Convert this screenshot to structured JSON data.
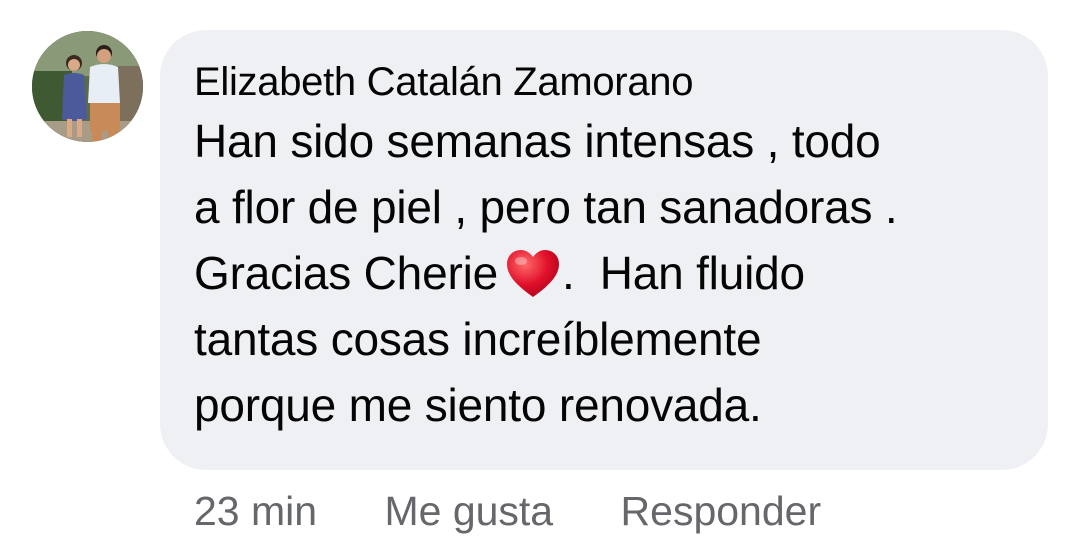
{
  "comment": {
    "author": "Elizabeth Catalán Zamorano",
    "lines": [
      "Han sido semanas intensas , todo",
      "a flor de piel , pero tan sanadoras .",
      "Gracias Cherie",
      ".  Han fluido",
      "tantas cosas increíblemente",
      "porque me siento renovada."
    ],
    "emoji": "red-heart-icon"
  },
  "actions": {
    "time": "23 min",
    "like": "Me gusta",
    "reply": "Responder"
  },
  "colors": {
    "bubble": "#eff0f4",
    "text": "#050505",
    "meta": "#65676b",
    "heart": "#e0102a"
  }
}
